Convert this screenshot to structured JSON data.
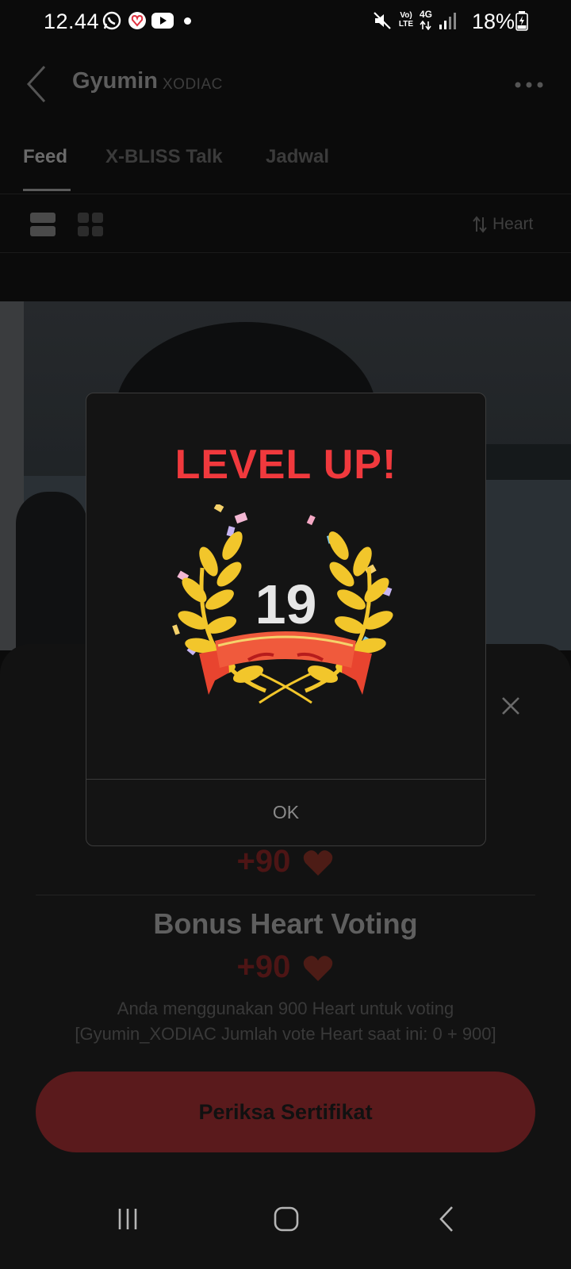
{
  "status_bar": {
    "time": "12.44",
    "network_volte": "Vo) LTE",
    "network_4g": "4G",
    "battery": "18%"
  },
  "header": {
    "title": "Gyumin",
    "subtitle": "XODIAC"
  },
  "tabs": [
    {
      "label": "Feed",
      "active": true
    },
    {
      "label": "X-BLISS Talk",
      "active": false
    },
    {
      "label": "Jadwal",
      "active": false
    }
  ],
  "toolbar": {
    "sort_label": "Heart"
  },
  "sheet": {
    "reward_top": "+90",
    "title": "Bonus Heart Voting",
    "reward_bottom": "+90",
    "desc_line1": "Anda menggunakan 900 Heart untuk voting",
    "desc_line2": "[Gyumin_XODIAC Jumlah vote Heart saat ini: 0 + 900]",
    "cert_button": "Periksa Sertifikat"
  },
  "modal": {
    "title": "LEVEL UP!",
    "level": "19",
    "ok_label": "OK"
  },
  "colors": {
    "accent_red": "#f0393d",
    "ribbon_red": "#e8442f",
    "laurel_gold": "#f2c62b",
    "button_dim_red": "#5a1a1c"
  },
  "icons": [
    "whatsapp-icon",
    "app-notification-icon",
    "youtube-icon",
    "mute-icon",
    "signal-icon",
    "battery-icon",
    "back-arrow-icon",
    "more-dots-icon",
    "list-view-icon",
    "grid-view-icon",
    "sort-icon",
    "close-icon",
    "heart-icon",
    "laurel-icon",
    "nav-recents-icon",
    "nav-home-icon",
    "nav-back-icon"
  ]
}
